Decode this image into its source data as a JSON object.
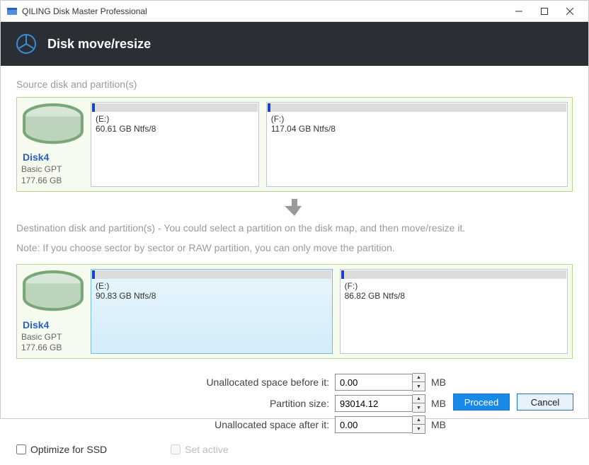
{
  "title": "QILING Disk Master Professional",
  "page_title": "Disk move/resize",
  "source_label": "Source disk and partition(s)",
  "source_disk": {
    "name": "Disk4",
    "meta": "Basic GPT",
    "size": "177.66 GB",
    "partitions": [
      {
        "letter": "(E:)",
        "info": "60.61 GB Ntfs/8",
        "flex": 1
      },
      {
        "letter": "(F:)",
        "info": "117.04 GB Ntfs/8",
        "flex": 1.8
      }
    ]
  },
  "destination_desc": "Destination disk and partition(s) - You could select a partition on the disk map, and then move/resize it.",
  "destination_note": "Note: If you choose sector by sector or RAW partition, you can only move the partition.",
  "destination_disk": {
    "name": "Disk4",
    "meta": "Basic GPT",
    "size": "177.66 GB",
    "partitions": [
      {
        "letter": "(E:)",
        "info": "90.83 GB Ntfs/8",
        "flex": 1.06,
        "selected": true
      },
      {
        "letter": "(F:)",
        "info": "86.82 GB Ntfs/8",
        "flex": 1,
        "selected": false
      }
    ]
  },
  "form": {
    "before_label": "Unallocated space before it:",
    "size_label": "Partition size:",
    "after_label": "Unallocated space after it:",
    "before_value": "0.00",
    "size_value": "93014.12",
    "after_value": "0.00",
    "unit": "MB"
  },
  "checks": {
    "ssd": "Optimize for SSD",
    "active": "Set active"
  },
  "buttons": {
    "proceed": "Proceed",
    "cancel": "Cancel"
  }
}
